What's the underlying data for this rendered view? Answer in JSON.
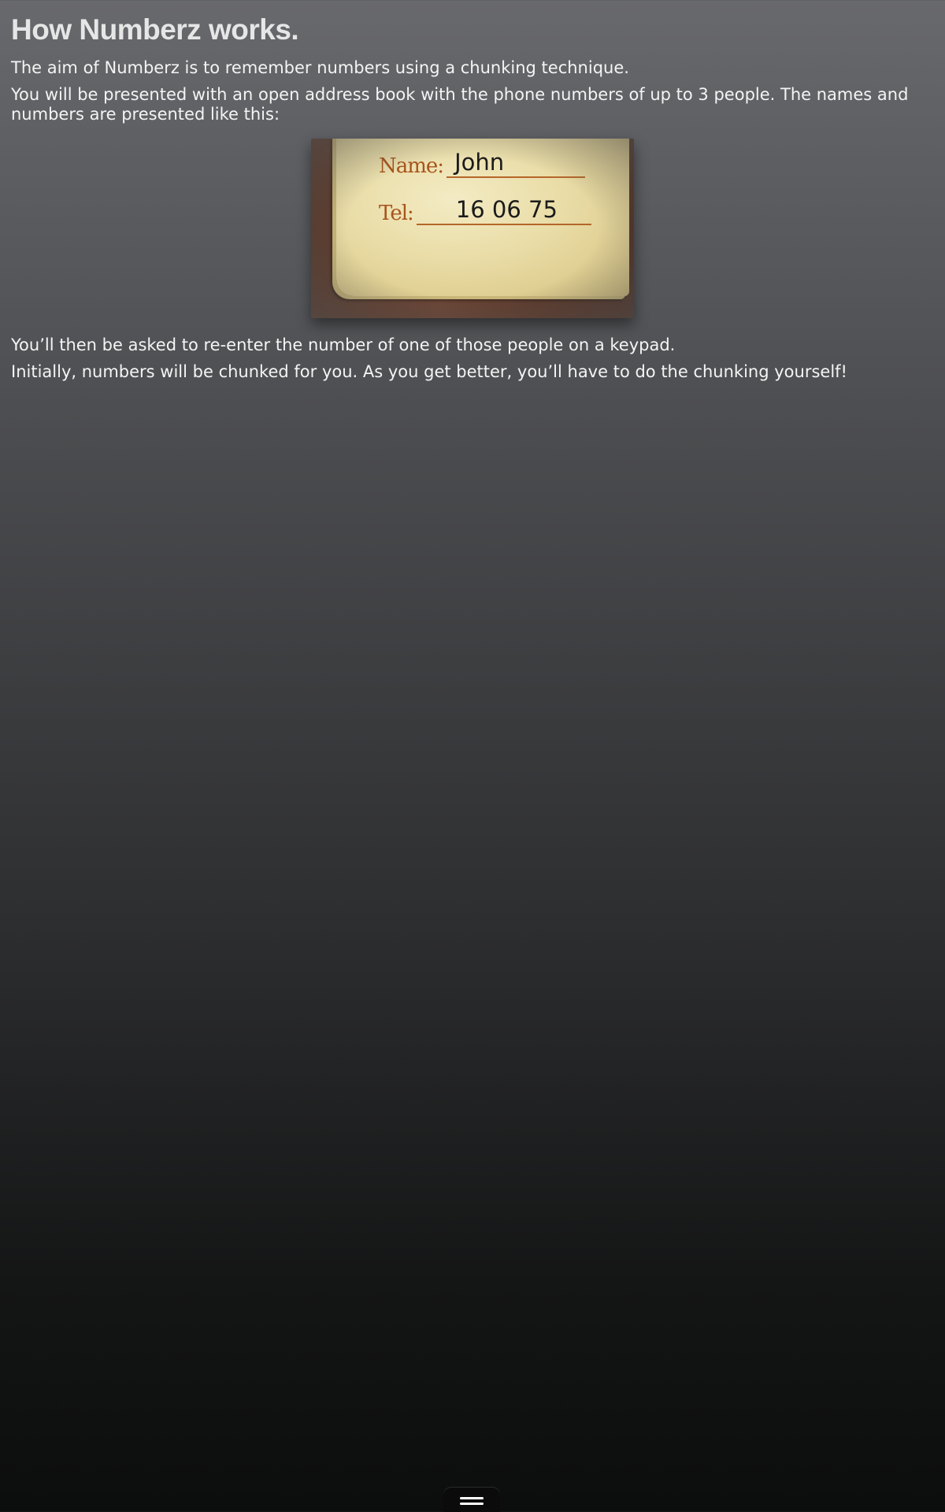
{
  "page": {
    "title": "How Numberz works.",
    "paragraphs": {
      "intro": "The aim of Numberz is to remember numbers using a chunking technique.",
      "presented": "You will be presented with an open address book with the phone numbers of up to 3 people. The names and numbers are presented like this:",
      "reenter": "You’ll then be asked to re-enter the number of one of those people on a keypad.",
      "chunking": "Initially, numbers will be chunked for you. As you get better, you’ll have to do the chunking yourself!"
    }
  },
  "example_card": {
    "name_label": "Name:",
    "name_value": "John",
    "tel_label": "Tel:",
    "tel_value": "16 06 75"
  },
  "footer": {
    "menu_icon": "hamburger-menu-icon"
  },
  "colors": {
    "heading": "#e6e6e6",
    "body_text": "#f4f4f4",
    "label_brown": "#a8541c"
  }
}
